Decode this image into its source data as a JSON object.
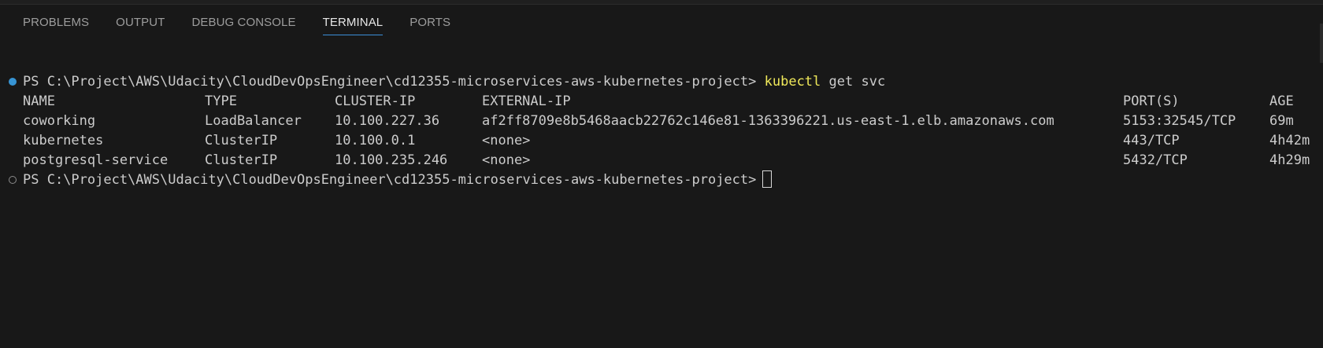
{
  "panel": {
    "tabs": [
      {
        "label": "PROBLEMS"
      },
      {
        "label": "OUTPUT"
      },
      {
        "label": "DEBUG CONSOLE"
      },
      {
        "label": "TERMINAL"
      },
      {
        "label": "PORTS"
      }
    ],
    "active_tab": "TERMINAL"
  },
  "terminal": {
    "prompt": "PS C:\\Project\\AWS\\Udacity\\CloudDevOpsEngineer\\cd12355-microservices-aws-kubernetes-project>",
    "command": {
      "program": "kubectl",
      "args": "get svc"
    },
    "table": {
      "headers": {
        "name": "NAME",
        "type": "TYPE",
        "cluster_ip": "CLUSTER-IP",
        "external_ip": "EXTERNAL-IP",
        "ports": "PORT(S)",
        "age": "AGE"
      },
      "rows": [
        {
          "name": "coworking",
          "type": "LoadBalancer",
          "cluster_ip": "10.100.227.36",
          "external_ip": "af2ff8709e8b5468aacb22762c146e81-1363396221.us-east-1.elb.amazonaws.com",
          "ports": "5153:32545/TCP",
          "age": "69m"
        },
        {
          "name": "kubernetes",
          "type": "ClusterIP",
          "cluster_ip": "10.100.0.1",
          "external_ip": "<none>",
          "ports": "443/TCP",
          "age": "4h42m"
        },
        {
          "name": "postgresql-service",
          "type": "ClusterIP",
          "cluster_ip": "10.100.235.246",
          "external_ip": "<none>",
          "ports": "5432/TCP",
          "age": "4h29m"
        }
      ]
    }
  },
  "colors": {
    "background": "#181818",
    "text": "#cccccc",
    "command": "#f0e95a",
    "active_tab_underline": "#3b8ed8",
    "success_decoration": "#3794d4"
  }
}
